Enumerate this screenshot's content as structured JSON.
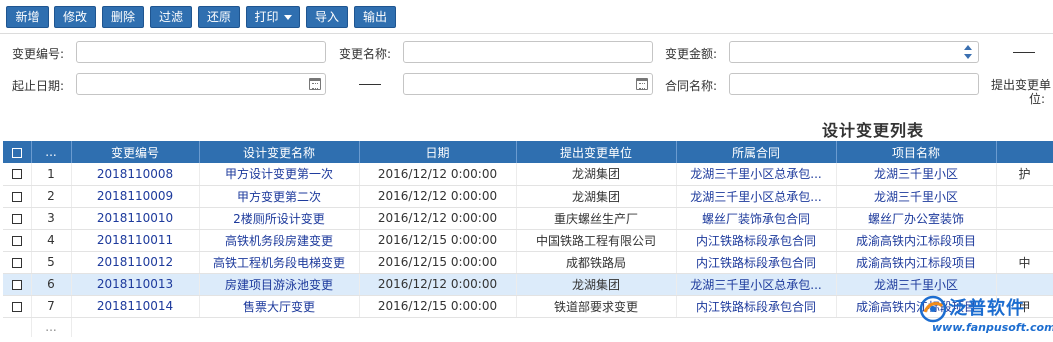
{
  "toolbar": {
    "buttons": [
      "新增",
      "修改",
      "删除",
      "过滤",
      "还原",
      "打印",
      "导入",
      "输出"
    ]
  },
  "filters": {
    "change_no_label": "变更编号:",
    "change_name_label": "变更名称:",
    "change_amount_label": "变更金额:",
    "date_range_label": "起止日期:",
    "contract_name_label": "合同名称:",
    "submit_unit_label_1": "提出变更单",
    "submit_unit_label_2": "位:",
    "change_no_value": "",
    "change_name_value": "",
    "change_amount_value": "",
    "date_start_value": "",
    "date_end_value": "",
    "contract_name_value": ""
  },
  "list_title": "设计变更列表",
  "table": {
    "columns": [
      "",
      "...",
      "变更编号",
      "设计变更名称",
      "日期",
      "提出变更单位",
      "所属合同",
      "项目名称",
      ""
    ],
    "rows": [
      {
        "idx": "1",
        "no": "2018110008",
        "name": "甲方设计变更第一次",
        "date": "2016/12/12 0:00:00",
        "unit": "龙湖集团",
        "contract": "龙湖三千里小区总承包...",
        "project": "龙湖三千里小区",
        "extra": "护"
      },
      {
        "idx": "2",
        "no": "2018110009",
        "name": "甲方变更第二次",
        "date": "2016/12/12 0:00:00",
        "unit": "龙湖集团",
        "contract": "龙湖三千里小区总承包...",
        "project": "龙湖三千里小区",
        "extra": ""
      },
      {
        "idx": "3",
        "no": "2018110010",
        "name": "2楼厕所设计变更",
        "date": "2016/12/12 0:00:00",
        "unit": "重庆螺丝生产厂",
        "contract": "螺丝厂装饰承包合同",
        "project": "螺丝厂办公室装饰",
        "extra": ""
      },
      {
        "idx": "4",
        "no": "2018110011",
        "name": "高铁机务段房建变更",
        "date": "2016/12/15 0:00:00",
        "unit": "中国铁路工程有限公司",
        "contract": "内江铁路标段承包合同",
        "project": "成渝高铁内江标段项目",
        "extra": ""
      },
      {
        "idx": "5",
        "no": "2018110012",
        "name": "高铁工程机务段电梯变更",
        "date": "2016/12/15 0:00:00",
        "unit": "成都铁路局",
        "contract": "内江铁路标段承包合同",
        "project": "成渝高铁内江标段项目",
        "extra": "中"
      },
      {
        "idx": "6",
        "no": "2018110013",
        "name": "房建项目游泳池变更",
        "date": "2016/12/12 0:00:00",
        "unit": "龙湖集团",
        "contract": "龙湖三千里小区总承包...",
        "project": "龙湖三千里小区",
        "extra": ""
      },
      {
        "idx": "7",
        "no": "2018110014",
        "name": "售票大厅变更",
        "date": "2016/12/15 0:00:00",
        "unit": "铁道部要求变更",
        "contract": "内江铁路标段承包合同",
        "project": "成渝高铁内江标段项目",
        "extra": "甲"
      }
    ],
    "more_indicator": "...",
    "selected_row": 6
  },
  "watermark": {
    "brand": "泛普软件",
    "url": "www.fanpusoft.com"
  },
  "colors": {
    "primary": "#2f6fb0",
    "link": "#1d3a9c",
    "selected_row": "#dcebfa",
    "watermark": "#1c6dd0"
  },
  "icons": [
    "calendar-icon",
    "spinner-icon",
    "dropdown-caret-icon",
    "checkbox-icon",
    "fanpu-logo-icon"
  ]
}
